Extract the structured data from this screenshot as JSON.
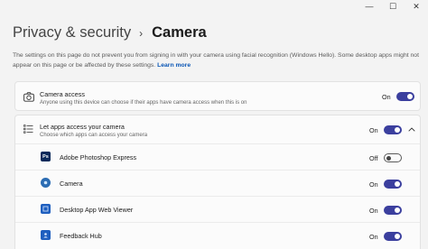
{
  "window": {
    "controls": {
      "minimize": "—",
      "maximize": "☐",
      "close": "✕"
    }
  },
  "breadcrumb": {
    "parent": "Privacy & security",
    "separator": "›",
    "current": "Camera"
  },
  "description": {
    "text": "The settings on this page do not prevent you from signing in with your camera using facial recognition (Windows Hello). Some desktop apps might not appear on this page or be affected by these settings.",
    "link": "Learn more"
  },
  "camera_access": {
    "icon": "camera-icon",
    "title": "Camera access",
    "subtitle": "Anyone using this device can choose if their apps have camera access when this is on",
    "state": "On",
    "enabled": true
  },
  "apps_access": {
    "icon": "app-list-icon",
    "title": "Let apps access your camera",
    "subtitle": "Choose which apps can access your camera",
    "state": "On",
    "enabled": true,
    "expanded": true
  },
  "apps": [
    {
      "name": "Adobe Photoshop Express",
      "icon": "photoshop-express-icon",
      "icon_text": "Ps",
      "icon_color": "#0b2a5a",
      "state": "Off",
      "enabled": false
    },
    {
      "name": "Camera",
      "icon": "camera-app-icon",
      "icon_text": "",
      "icon_color": "#2b6cb3",
      "state": "On",
      "enabled": true
    },
    {
      "name": "Desktop App Web Viewer",
      "icon": "web-viewer-icon",
      "icon_text": "",
      "icon_color": "#1f5fbf",
      "state": "On",
      "enabled": true
    },
    {
      "name": "Feedback Hub",
      "icon": "feedback-hub-icon",
      "icon_text": "",
      "icon_color": "#1f5fbf",
      "state": "On",
      "enabled": true
    }
  ],
  "colors": {
    "accent": "#3b3f9e",
    "link": "#0a56b5",
    "background": "#f3f3f3",
    "card": "#fbfbfb"
  }
}
